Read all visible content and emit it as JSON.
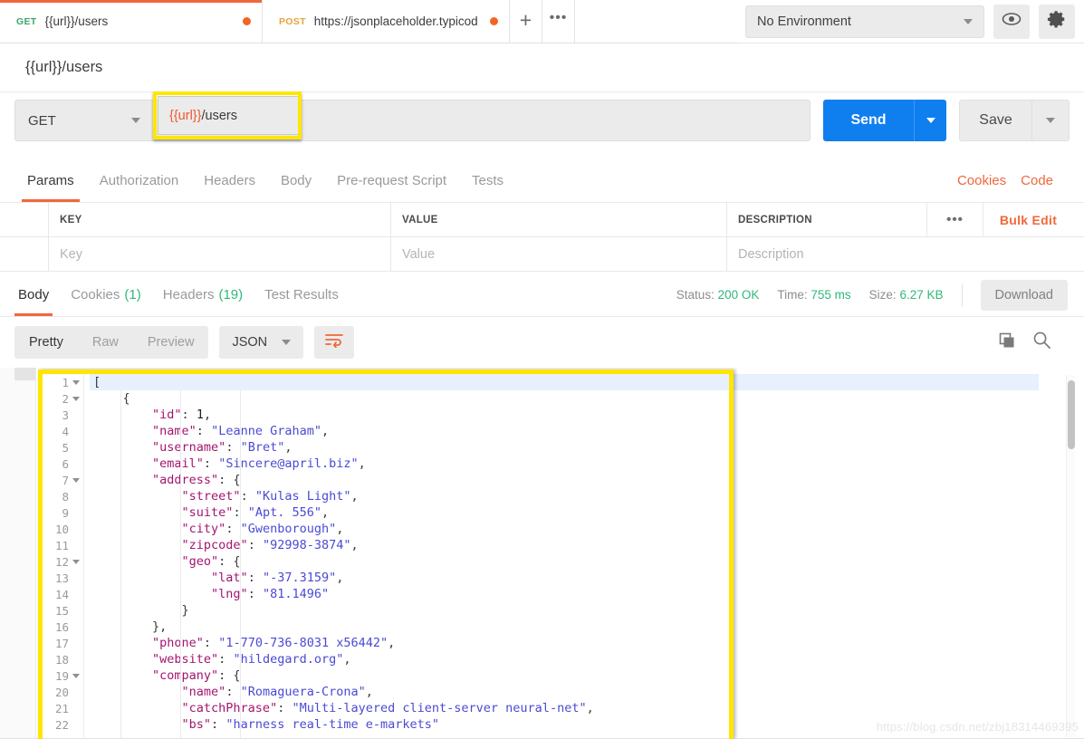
{
  "tabs": {
    "items": [
      {
        "method": "GET",
        "name": "{{url}}/users",
        "dirty": true,
        "active": true
      },
      {
        "method": "POST",
        "name": "https://jsonplaceholder.typicod",
        "dirty": true,
        "active": false
      }
    ],
    "new_tab_label": "+",
    "more_label": "•••"
  },
  "environment": {
    "selected": "No Environment",
    "eye_icon": "eye-icon",
    "settings_icon": "gear-icon"
  },
  "request": {
    "name": "{{url}}/users",
    "method": "GET",
    "url_variable": "{{url}}",
    "url_path": "/users",
    "url_full": "{{url}}/users",
    "send_label": "Send",
    "save_label": "Save"
  },
  "request_tabs": {
    "items": [
      "Params",
      "Authorization",
      "Headers",
      "Body",
      "Pre-request Script",
      "Tests"
    ],
    "active": "Params",
    "cookies_label": "Cookies",
    "code_label": "Code"
  },
  "params_table": {
    "headers": [
      "KEY",
      "VALUE",
      "DESCRIPTION"
    ],
    "placeholder_row": [
      "Key",
      "Value",
      "Description"
    ],
    "dots_label": "•••",
    "bulk_edit_label": "Bulk Edit"
  },
  "response_tabs": {
    "items": [
      {
        "label": "Body",
        "count": null,
        "active": true
      },
      {
        "label": "Cookies",
        "count": "(1)",
        "active": false
      },
      {
        "label": "Headers",
        "count": "(19)",
        "active": false
      },
      {
        "label": "Test Results",
        "count": null,
        "active": false
      }
    ],
    "status_label": "Status:",
    "status_value": "200 OK",
    "time_label": "Time:",
    "time_value": "755 ms",
    "size_label": "Size:",
    "size_value": "6.27 KB",
    "download_label": "Download"
  },
  "body_toolbar": {
    "views": [
      "Pretty",
      "Raw",
      "Preview"
    ],
    "active_view": "Pretty",
    "format": "JSON",
    "wrap_icon": "text-wrap-icon",
    "copy_icon": "copy-icon",
    "search_icon": "search-icon"
  },
  "colors": {
    "accent_orange": "#f0673a",
    "send_blue": "#0f7ff0",
    "status_green": "#2fb87a",
    "highlight_yellow": "#ffe600",
    "json_key": "#a3156f",
    "json_string": "#4a4ad4"
  },
  "response_body": {
    "language": "json",
    "lines": [
      {
        "num": 1,
        "fold": true,
        "tokens": [
          {
            "t": "p",
            "v": "["
          }
        ]
      },
      {
        "num": 2,
        "fold": true,
        "tokens": [
          {
            "t": "p",
            "v": "    {"
          }
        ]
      },
      {
        "num": 3,
        "fold": false,
        "tokens": [
          {
            "t": "k",
            "v": "        \"id\""
          },
          {
            "t": "p",
            "v": ": "
          },
          {
            "t": "n",
            "v": "1"
          },
          {
            "t": "p",
            "v": ","
          }
        ]
      },
      {
        "num": 4,
        "fold": false,
        "tokens": [
          {
            "t": "k",
            "v": "        \"name\""
          },
          {
            "t": "p",
            "v": ": "
          },
          {
            "t": "s",
            "v": "\"Leanne Graham\""
          },
          {
            "t": "p",
            "v": ","
          }
        ]
      },
      {
        "num": 5,
        "fold": false,
        "tokens": [
          {
            "t": "k",
            "v": "        \"username\""
          },
          {
            "t": "p",
            "v": ": "
          },
          {
            "t": "s",
            "v": "\"Bret\""
          },
          {
            "t": "p",
            "v": ","
          }
        ]
      },
      {
        "num": 6,
        "fold": false,
        "tokens": [
          {
            "t": "k",
            "v": "        \"email\""
          },
          {
            "t": "p",
            "v": ": "
          },
          {
            "t": "s",
            "v": "\"Sincere@april.biz\""
          },
          {
            "t": "p",
            "v": ","
          }
        ]
      },
      {
        "num": 7,
        "fold": true,
        "tokens": [
          {
            "t": "k",
            "v": "        \"address\""
          },
          {
            "t": "p",
            "v": ": {"
          }
        ]
      },
      {
        "num": 8,
        "fold": false,
        "tokens": [
          {
            "t": "k",
            "v": "            \"street\""
          },
          {
            "t": "p",
            "v": ": "
          },
          {
            "t": "s",
            "v": "\"Kulas Light\""
          },
          {
            "t": "p",
            "v": ","
          }
        ]
      },
      {
        "num": 9,
        "fold": false,
        "tokens": [
          {
            "t": "k",
            "v": "            \"suite\""
          },
          {
            "t": "p",
            "v": ": "
          },
          {
            "t": "s",
            "v": "\"Apt. 556\""
          },
          {
            "t": "p",
            "v": ","
          }
        ]
      },
      {
        "num": 10,
        "fold": false,
        "tokens": [
          {
            "t": "k",
            "v": "            \"city\""
          },
          {
            "t": "p",
            "v": ": "
          },
          {
            "t": "s",
            "v": "\"Gwenborough\""
          },
          {
            "t": "p",
            "v": ","
          }
        ]
      },
      {
        "num": 11,
        "fold": false,
        "tokens": [
          {
            "t": "k",
            "v": "            \"zipcode\""
          },
          {
            "t": "p",
            "v": ": "
          },
          {
            "t": "s",
            "v": "\"92998-3874\""
          },
          {
            "t": "p",
            "v": ","
          }
        ]
      },
      {
        "num": 12,
        "fold": true,
        "tokens": [
          {
            "t": "k",
            "v": "            \"geo\""
          },
          {
            "t": "p",
            "v": ": {"
          }
        ]
      },
      {
        "num": 13,
        "fold": false,
        "tokens": [
          {
            "t": "k",
            "v": "                \"lat\""
          },
          {
            "t": "p",
            "v": ": "
          },
          {
            "t": "s",
            "v": "\"-37.3159\""
          },
          {
            "t": "p",
            "v": ","
          }
        ]
      },
      {
        "num": 14,
        "fold": false,
        "tokens": [
          {
            "t": "k",
            "v": "                \"lng\""
          },
          {
            "t": "p",
            "v": ": "
          },
          {
            "t": "s",
            "v": "\"81.1496\""
          }
        ]
      },
      {
        "num": 15,
        "fold": false,
        "tokens": [
          {
            "t": "p",
            "v": "            }"
          }
        ]
      },
      {
        "num": 16,
        "fold": false,
        "tokens": [
          {
            "t": "p",
            "v": "        },"
          }
        ]
      },
      {
        "num": 17,
        "fold": false,
        "tokens": [
          {
            "t": "k",
            "v": "        \"phone\""
          },
          {
            "t": "p",
            "v": ": "
          },
          {
            "t": "s",
            "v": "\"1-770-736-8031 x56442\""
          },
          {
            "t": "p",
            "v": ","
          }
        ]
      },
      {
        "num": 18,
        "fold": false,
        "tokens": [
          {
            "t": "k",
            "v": "        \"website\""
          },
          {
            "t": "p",
            "v": ": "
          },
          {
            "t": "s",
            "v": "\"hildegard.org\""
          },
          {
            "t": "p",
            "v": ","
          }
        ]
      },
      {
        "num": 19,
        "fold": true,
        "tokens": [
          {
            "t": "k",
            "v": "        \"company\""
          },
          {
            "t": "p",
            "v": ": {"
          }
        ]
      },
      {
        "num": 20,
        "fold": false,
        "tokens": [
          {
            "t": "k",
            "v": "            \"name\""
          },
          {
            "t": "p",
            "v": ": "
          },
          {
            "t": "s",
            "v": "\"Romaguera-Crona\""
          },
          {
            "t": "p",
            "v": ","
          }
        ]
      },
      {
        "num": 21,
        "fold": false,
        "tokens": [
          {
            "t": "k",
            "v": "            \"catchPhrase\""
          },
          {
            "t": "p",
            "v": ": "
          },
          {
            "t": "s",
            "v": "\"Multi-layered client-server neural-net\""
          },
          {
            "t": "p",
            "v": ","
          }
        ]
      },
      {
        "num": 22,
        "fold": false,
        "tokens": [
          {
            "t": "k",
            "v": "            \"bs\""
          },
          {
            "t": "p",
            "v": ": "
          },
          {
            "t": "s",
            "v": "\"harness real-time e-markets\""
          }
        ]
      }
    ]
  },
  "watermark": "https://blog.csdn.net/zbj18314469395"
}
